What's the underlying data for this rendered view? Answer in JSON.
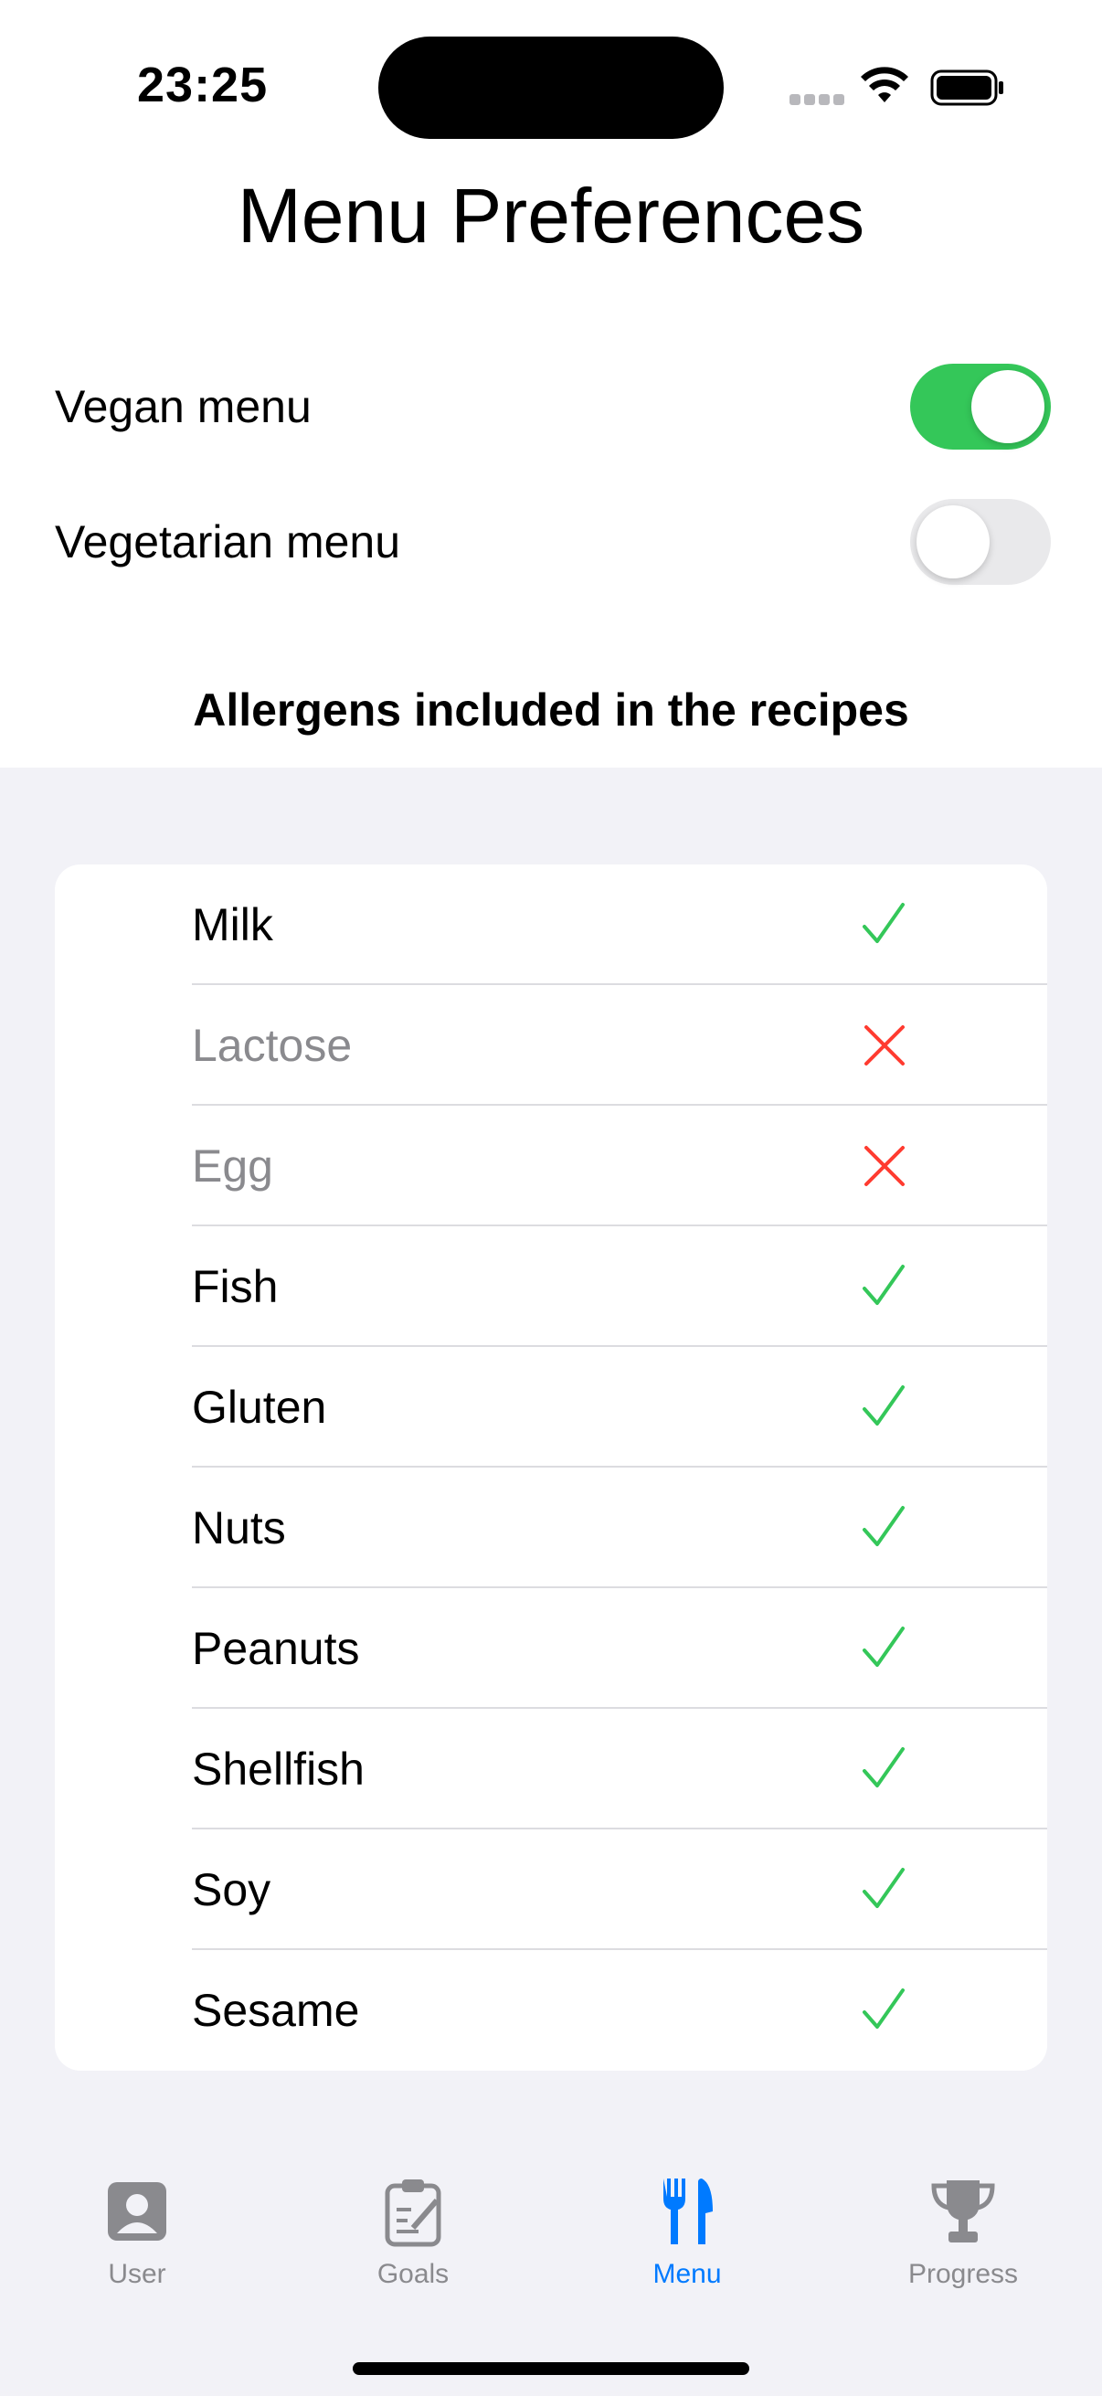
{
  "status_bar": {
    "time": "23:25"
  },
  "page": {
    "title": "Menu Preferences"
  },
  "toggles": [
    {
      "label": "Vegan menu",
      "on": true
    },
    {
      "label": "Vegetarian menu",
      "on": false
    }
  ],
  "allergens": {
    "heading": "Allergens included in the recipes",
    "items": [
      {
        "name": "Milk",
        "included": true
      },
      {
        "name": "Lactose",
        "included": false
      },
      {
        "name": "Egg",
        "included": false
      },
      {
        "name": "Fish",
        "included": true
      },
      {
        "name": "Gluten",
        "included": true
      },
      {
        "name": "Nuts",
        "included": true
      },
      {
        "name": "Peanuts",
        "included": true
      },
      {
        "name": "Shellfish",
        "included": true
      },
      {
        "name": "Soy",
        "included": true
      },
      {
        "name": "Sesame",
        "included": true
      }
    ]
  },
  "tab_bar": {
    "tabs": [
      {
        "label": "User",
        "icon": "person-icon",
        "active": false
      },
      {
        "label": "Goals",
        "icon": "clipboard-icon",
        "active": false
      },
      {
        "label": "Menu",
        "icon": "fork-knife-icon",
        "active": true
      },
      {
        "label": "Progress",
        "icon": "trophy-icon",
        "active": false
      }
    ]
  },
  "colors": {
    "accent": "#007aff",
    "toggle_on": "#34c759",
    "check": "#34c759",
    "cross": "#ff3b30",
    "inactive": "#8a8a8e",
    "grouped_background": "#f2f2f7"
  }
}
